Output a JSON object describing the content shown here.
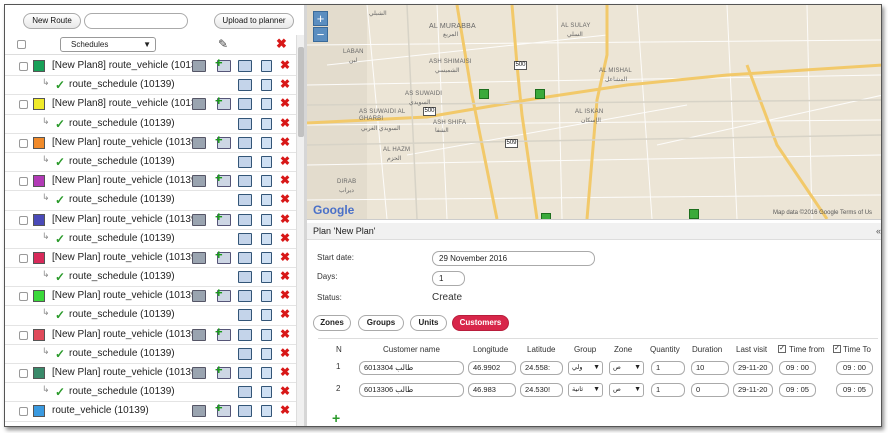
{
  "toolbar": {
    "new_route": "New Route",
    "upload": "Upload to planner"
  },
  "header": {
    "schedules": "Schedules"
  },
  "routes": [
    {
      "name": "[New Plan8] route_vehicle (10139)",
      "color": "#18a058",
      "schedule": "route_schedule (10139)"
    },
    {
      "name": "[New Plan8] route_vehicle (10139)",
      "color": "#f0ea2a",
      "schedule": "route_schedule (10139)"
    },
    {
      "name": "[New Plan] route_vehicle (10139)",
      "color": "#f08a2a",
      "schedule": "route_schedule (10139)"
    },
    {
      "name": "[New Plan] route_vehicle (10139)",
      "color": "#b23ab6",
      "schedule": "route_schedule (10139)"
    },
    {
      "name": "[New Plan] route_vehicle (10139)",
      "color": "#4a4ab8",
      "schedule": "route_schedule (10139)"
    },
    {
      "name": "[New Plan] route_vehicle (10139)",
      "color": "#d82a5a",
      "schedule": "route_schedule (10139)"
    },
    {
      "name": "[New Plan] route_vehicle (10139)",
      "color": "#3ad83a",
      "schedule": "route_schedule (10139)"
    },
    {
      "name": "[New Plan] route_vehicle (10139)",
      "color": "#e04a5a",
      "schedule": "route_schedule (10139)"
    },
    {
      "name": "[New Plan] route_vehicle (10139)",
      "color": "#3a8a6a",
      "schedule": "route_schedule (10139)"
    },
    {
      "name": "route_vehicle (10139)",
      "color": "#3a9ae0",
      "schedule": null
    }
  ],
  "map": {
    "labels": [
      "الشبلي",
      "AL MURABBA",
      "المربع",
      "ASH SHIMAISI",
      "الشميسي",
      "AS SUWAIDI",
      "السويدي",
      "AS SUWAIDI AL GHARBI",
      "السويدي الغربي",
      "ASH SHIFA",
      "الشفا",
      "AL HAZM",
      "الحزم",
      "DIRAB",
      "ديراب",
      "AL MISHAL",
      "المشاعل",
      "AL ISKAN",
      "الإسكان",
      "AL SULAY",
      "السلي",
      "LABAN",
      "لبن"
    ],
    "roads": [
      "500",
      "500",
      "509"
    ],
    "attribution": "Map data ©2016 Google   Terms of Us",
    "brand": "Google"
  },
  "plan": {
    "title": "Plan 'New Plan'",
    "start_label": "Start date:",
    "start_value": "29 November 2016",
    "days_label": "Days:",
    "days_value": "1",
    "status_label": "Status:",
    "status_value": "Create",
    "tabs": [
      "Zones",
      "Groups",
      "Units",
      "Customers"
    ],
    "active_tab": "Customers"
  },
  "grid": {
    "headers": [
      "N",
      "Customer name",
      "Longitude",
      "Latitude",
      "Group",
      "Zone",
      "Quantity",
      "Duration",
      "Last visit",
      "Time from",
      "Time To"
    ],
    "rows": [
      {
        "n": "1",
        "name": "6013304 طالب",
        "lon": "46.9902",
        "lat": "24.558:",
        "group": "ولي",
        "zone": "ص",
        "qty": "1",
        "dur": "10",
        "last": "29-11-20",
        "from": "09 : 00",
        "to": "09 : 00"
      },
      {
        "n": "2",
        "name": "6013306 طالب",
        "lon": "46.983",
        "lat": "24.530!",
        "group": "ثانية",
        "zone": "ص",
        "qty": "1",
        "dur": "0",
        "last": "29-11-20",
        "from": "09 : 05",
        "to": "09 : 05"
      }
    ]
  }
}
